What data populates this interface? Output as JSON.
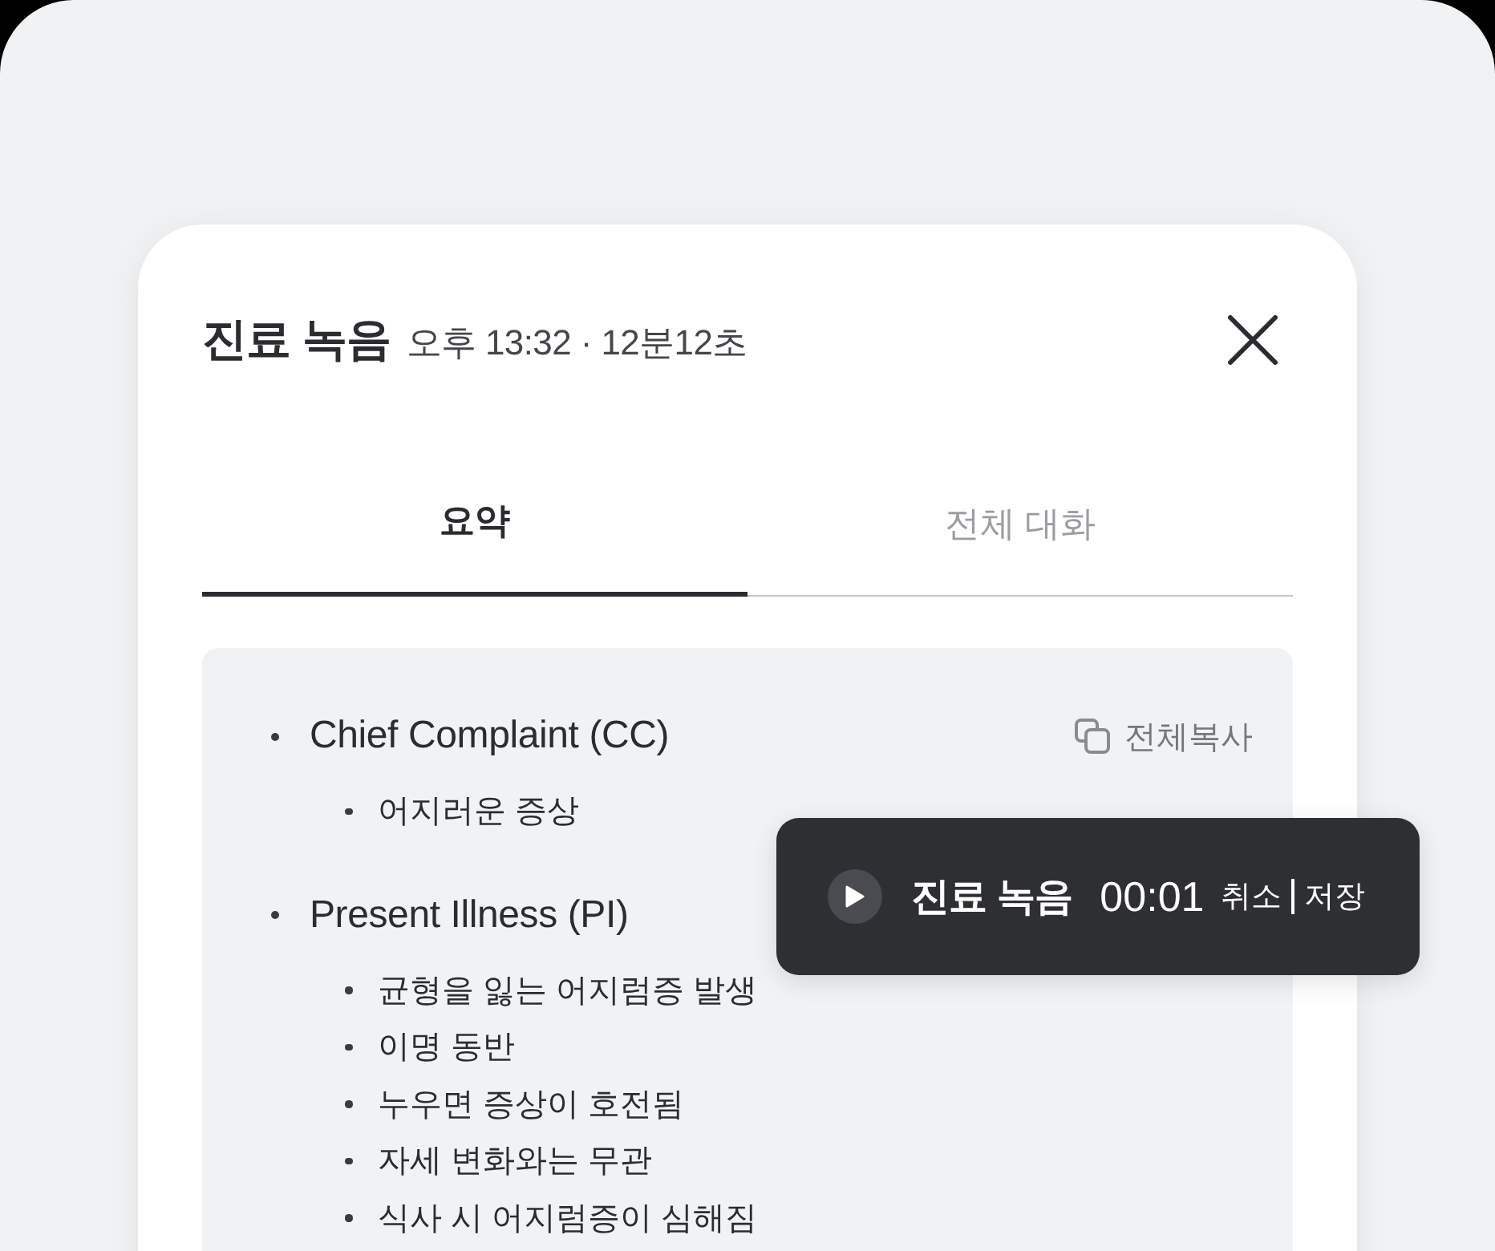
{
  "header": {
    "title": "진료 녹음",
    "subtitle": "오후 13:32 · 12분12초"
  },
  "tabs": [
    {
      "label": "요약",
      "selected": true
    },
    {
      "label": "전체 대화",
      "selected": false
    }
  ],
  "summary": {
    "copy_button": "전체복사",
    "items": [
      {
        "text": "Chief Complaint (CC)",
        "children": [
          {
            "text": "어지러운 증상"
          }
        ]
      },
      {
        "text": "Present Illness (PI)",
        "children": [
          {
            "text": "균형을 잃는 어지럼증 발생"
          },
          {
            "text": "이명 동반"
          },
          {
            "text": "누우면 증상이 호전됨"
          },
          {
            "text": "자세 변화와는 무관"
          },
          {
            "text": "식사 시 어지럼증이 심해짐"
          }
        ]
      }
    ]
  },
  "recording_toast": {
    "title": "진료 녹음",
    "time": "00:01",
    "actions": [
      "취소",
      "저장"
    ]
  }
}
